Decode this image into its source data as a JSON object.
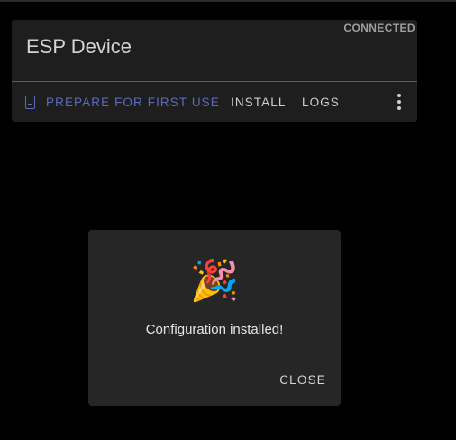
{
  "device": {
    "name": "ESP Device",
    "status": "CONNECTED"
  },
  "actions": {
    "prepare": "PREPARE FOR FIRST USE",
    "install": "INSTALL",
    "logs": "LOGS",
    "more_icon": "more-vert-icon"
  },
  "dialog": {
    "emoji": "🎉",
    "message": "Configuration installed!",
    "close": "CLOSE"
  },
  "colors": {
    "accent": "#5c6bc0",
    "card_bg": "#1e1e1e",
    "dialog_bg": "#262626"
  }
}
